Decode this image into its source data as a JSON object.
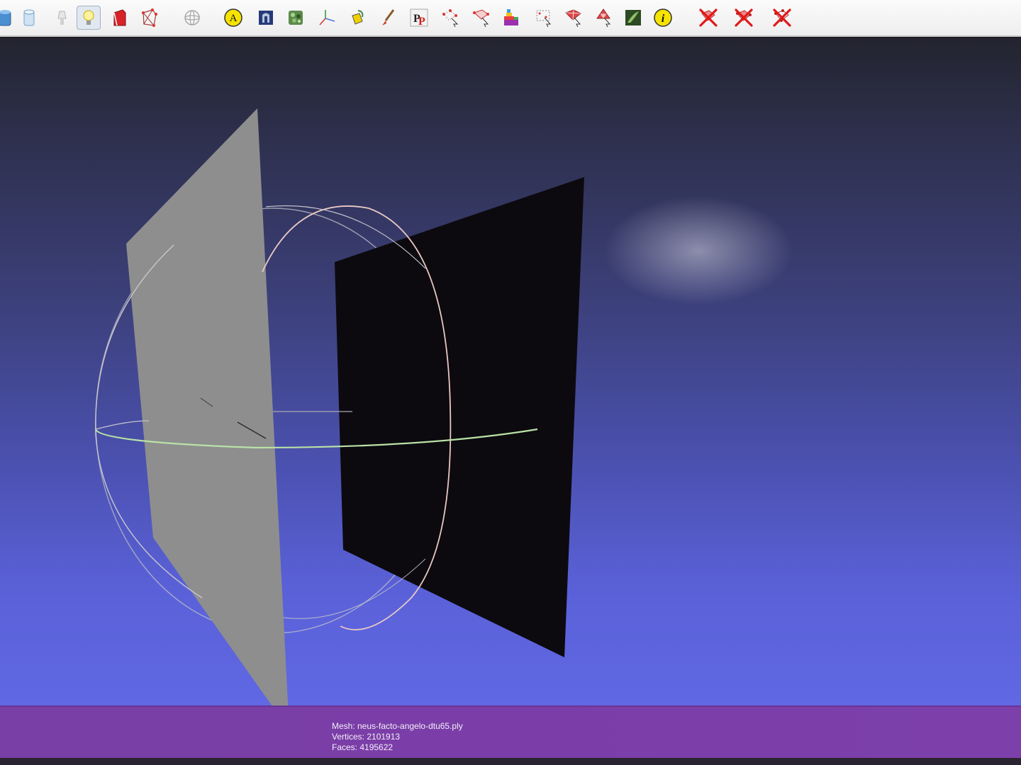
{
  "toolbar": {
    "buttons": [
      {
        "id": "view-cylinder-blue",
        "icon": "cylinder-icon"
      },
      {
        "id": "view-cylinder-light",
        "icon": "cylinder-outline-icon"
      },
      {
        "id": "lamp-off",
        "icon": "lamp-icon"
      },
      {
        "id": "light",
        "icon": "light-bulb-icon",
        "active": true
      },
      {
        "id": "backface",
        "icon": "red-box-icon"
      },
      {
        "id": "wireframe-box",
        "icon": "wireframe-box-icon"
      },
      {
        "id": "trackball",
        "icon": "trackball-icon"
      },
      {
        "id": "annotation",
        "icon": "annotation-a-icon",
        "label": "A"
      },
      {
        "id": "texture",
        "icon": "texture-icon"
      },
      {
        "id": "green-texture",
        "icon": "green-pattern-icon"
      },
      {
        "id": "axes",
        "icon": "axes-icon"
      },
      {
        "id": "color-paint",
        "icon": "paint-bucket-icon"
      },
      {
        "id": "brush",
        "icon": "brush-icon"
      },
      {
        "id": "pick-points",
        "icon": "pp-icon",
        "label": "PP"
      },
      {
        "id": "select-vertices",
        "icon": "select-vertices-icon"
      },
      {
        "id": "select-connected",
        "icon": "select-connected-icon"
      },
      {
        "id": "select-rainbow",
        "icon": "rainbow-select-icon"
      },
      {
        "id": "select-region",
        "icon": "select-region-icon"
      },
      {
        "id": "select-faces",
        "icon": "select-faces-icon"
      },
      {
        "id": "select-faces-2",
        "icon": "select-faces-alt-icon"
      },
      {
        "id": "green-image",
        "icon": "green-image-icon"
      },
      {
        "id": "info",
        "icon": "info-icon",
        "label": "i"
      },
      {
        "id": "delete-faces",
        "icon": "delete-faces-icon"
      },
      {
        "id": "delete-vertices",
        "icon": "delete-vertices-icon"
      },
      {
        "id": "delete-all",
        "icon": "delete-all-icon"
      }
    ]
  },
  "info": {
    "mesh": "Mesh: neus-facto-angelo-dtu65.ply",
    "vertices": "Vertices: 2101913",
    "faces": "Faces: 4195622"
  },
  "colors": {
    "infobar": "#7b3ea8",
    "viewport_top": "#23242f",
    "viewport_bottom": "#6068e4",
    "light_plane": "#8f8f90",
    "dark_plane": "#0d0b10",
    "sphere_lines": "#c8c8cc",
    "equator_line": "#b8e0a8"
  }
}
